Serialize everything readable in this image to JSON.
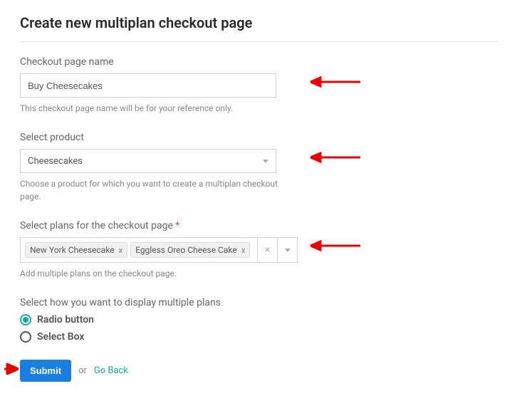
{
  "title": "Create new multiplan checkout page",
  "checkout_name": {
    "label": "Checkout page name",
    "value": "Buy Cheesecakes",
    "help": "This checkout page name will be for your reference only."
  },
  "select_product": {
    "label": "Select product",
    "value": "Cheesecakes",
    "help": "Choose a product for which you want to create a multiplan checkout page."
  },
  "select_plans": {
    "label": "Select plans for the checkout page",
    "required_mark": "*",
    "chips": [
      "New York Cheesecake",
      "Eggless Oreo Cheese Cake"
    ],
    "help": "Add multiple plans on the checkout page."
  },
  "display_mode": {
    "label": "Select how you want to display multiple plans",
    "options": [
      {
        "label": "Radio button",
        "selected": true
      },
      {
        "label": "Select Box",
        "selected": false
      }
    ]
  },
  "footer": {
    "submit": "Submit",
    "or": "or",
    "go_back": "Go Back"
  }
}
